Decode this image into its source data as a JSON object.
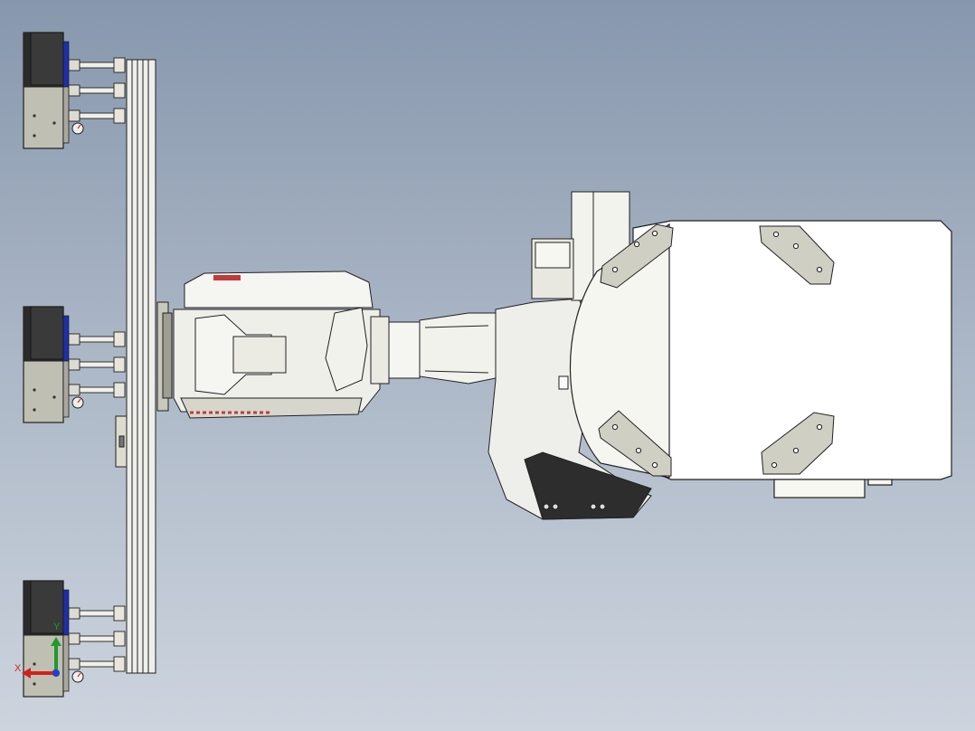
{
  "viewport": {
    "background_top": "#8797ad",
    "background_bottom": "#cdd4de"
  },
  "model": {
    "description": "robot-arm-with-vacuum-gripper-end-effector",
    "body_color": "#f5f5f2",
    "shadow_color": "#d6d6cc",
    "edge_color": "#202020",
    "plate_color": "#cfcfc4",
    "vacuum_unit_dark": "#2b2b2b",
    "vacuum_unit_light": "#bfbfb4",
    "accent_blue": "#1f2fa8"
  },
  "triad": {
    "x_label": "X",
    "y_label": "Y",
    "x_color": "#d22020",
    "y_color": "#1f9a2c",
    "z_color": "#2040d0"
  }
}
